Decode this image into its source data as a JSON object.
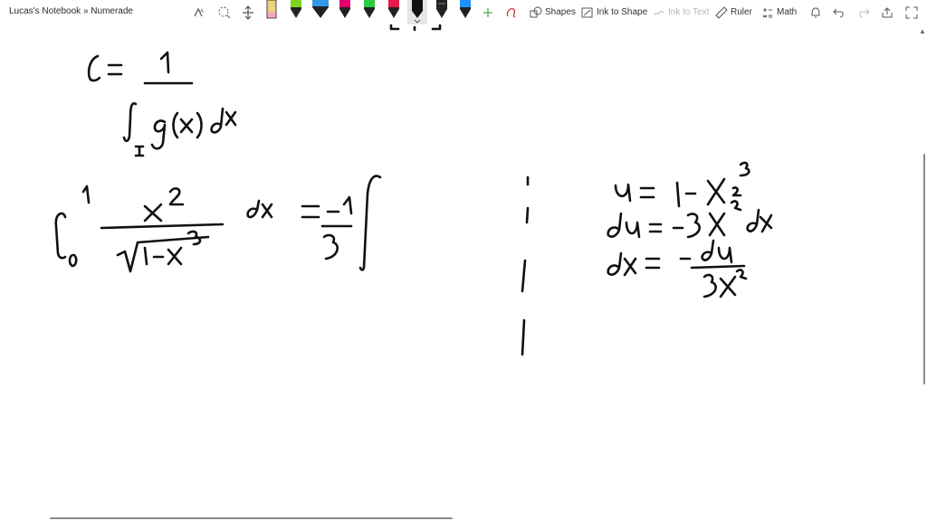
{
  "breadcrumb": "Lucas's Notebook » Numerade",
  "toolbar": {
    "shapes_label": "Shapes",
    "ink_to_shape_label": "Ink to Shape",
    "ink_to_text_label": "Ink to Text",
    "ruler_label": "Ruler",
    "math_label": "Math"
  },
  "pens": [
    {
      "color": "#f3a6c8",
      "kind": "highlighter"
    },
    {
      "color": "#7ed321"
    },
    {
      "color": "#2f9be6"
    },
    {
      "color": "#e0006f"
    },
    {
      "color": "#2ecc40"
    },
    {
      "color": "#e8194a"
    },
    {
      "color": "#111111",
      "selected": true
    },
    {
      "color": "#222222"
    },
    {
      "color": "#1e90ff"
    }
  ]
}
